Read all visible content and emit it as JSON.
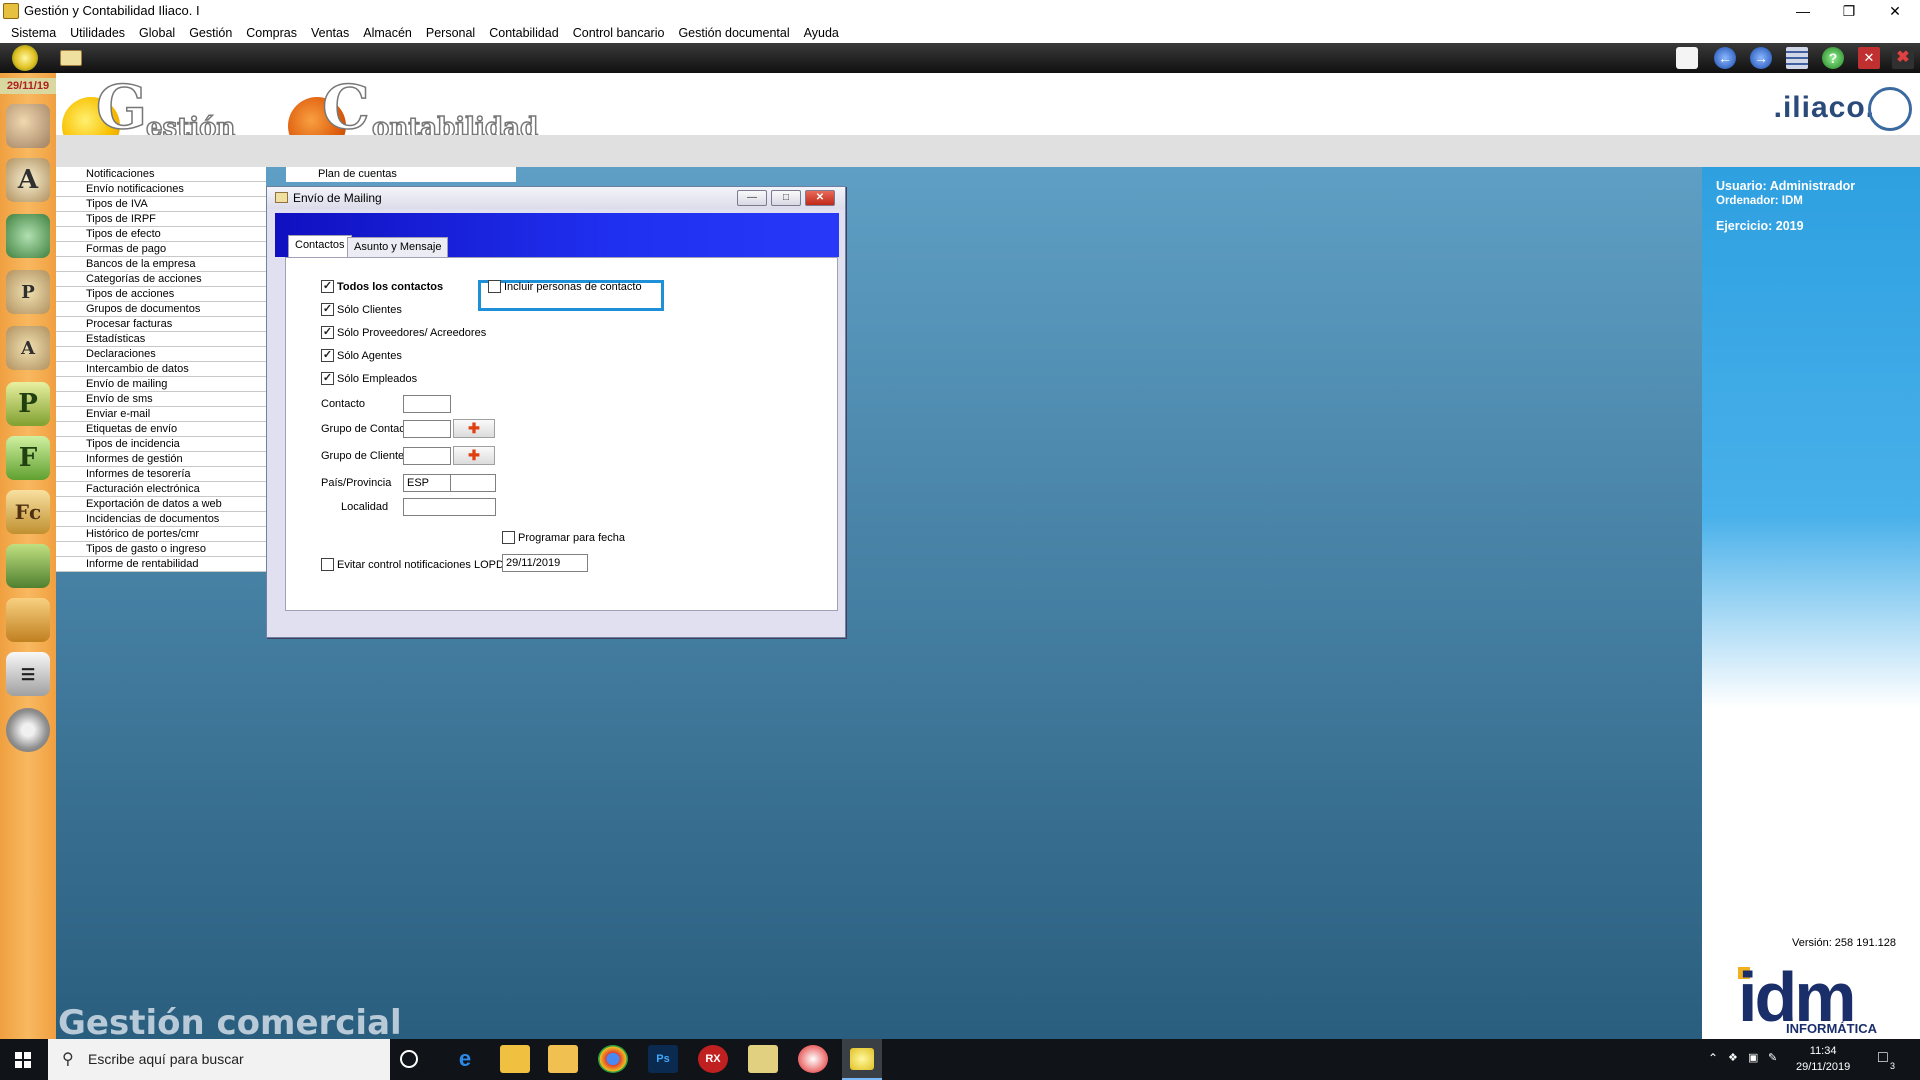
{
  "window": {
    "title": "Gestión y Contabilidad Iliaco. I"
  },
  "menu": [
    "Sistema",
    "Utilidades",
    "Global",
    "Gestión",
    "Compras",
    "Ventas",
    "Almacén",
    "Personal",
    "Contabilidad",
    "Control bancario",
    "Gestión documental",
    "Ayuda"
  ],
  "date_badge": "29/11/19",
  "logos": {
    "gestion_initial": "G",
    "gestion_rest": "estión",
    "contab_initial": "C",
    "contab_rest": "ontabilidad",
    "brand": ".iliaco."
  },
  "nav_items": [
    "Notificaciones",
    "Envío notificaciones",
    "Tipos de IVA",
    "Tipos de IRPF",
    "Tipos de efecto",
    "Formas de pago",
    "Bancos de la empresa",
    "Categorías de acciones",
    "Tipos de acciones",
    "Grupos de documentos",
    "Procesar facturas",
    "Estadísticas",
    "Declaraciones",
    "Intercambio de datos",
    "Envío de mailing",
    "Envío de sms",
    "Enviar e-mail",
    "Etiquetas de envío",
    "Tipos de incidencia",
    "Informes de gestión",
    "Informes de tesorería",
    "Facturación electrónica",
    "Exportación de datos a web",
    "Incidencias de documentos",
    "Histórico de portes/cmr",
    "Tipos de gasto o ingreso",
    "Informe de rentabilidad"
  ],
  "plan_tab": "Plan de cuentas",
  "dialog": {
    "title": "Envío de Mailing",
    "tabs": [
      "Contactos",
      "Asunto y Mensaje"
    ],
    "checks": {
      "todos": {
        "label": "Todos los contactos",
        "checked": true
      },
      "clientes": {
        "label": "Sólo Clientes",
        "checked": true
      },
      "proveedores": {
        "label": "Sólo Proveedores/ Acreedores",
        "checked": true
      },
      "agentes": {
        "label": "Sólo Agentes",
        "checked": true
      },
      "empleados": {
        "label": "Sólo Empleados",
        "checked": true
      },
      "incluir": {
        "label": "Incluir personas de contacto",
        "checked": false
      },
      "programar": {
        "label": "Programar para fecha",
        "checked": false
      },
      "lopd": {
        "label": "Evitar control notificaciones LOPD",
        "checked": false
      }
    },
    "fields": {
      "contacto_label": "Contacto",
      "contacto_value": "",
      "grupo_contactos_label": "Grupo de Contactos",
      "grupo_contactos_value": "",
      "grupo_clientes_label": "Grupo de Clientes",
      "grupo_clientes_value": "",
      "pais_label": "País/Provincia",
      "pais_value": "ESP",
      "provincia_value": "",
      "localidad_label": "Localidad",
      "localidad_value": "",
      "fecha_value": "29/11/2019"
    },
    "add_icon": "add-folder-icon"
  },
  "right_panel": {
    "usuario": "Usuario: Administrador",
    "ordenador": "Ordenador:  IDM",
    "ejercicio": "Ejercicio: 2019",
    "version": "Versión: 258 191.128",
    "logo": "idm",
    "logo_sub": "INFORMÁTICA"
  },
  "bottom_label": "Gestión comercial",
  "taskbar": {
    "search_placeholder": "Escribe aquí para buscar",
    "time": "11:34",
    "date": "29/11/2019",
    "notif_count": "3",
    "rx_label": "RX",
    "ps_label": "Ps"
  },
  "colors": {
    "accent": "#1e90d8",
    "dialog_header": "#1010c0",
    "right_panel": "#2ea0e0",
    "desktop": "#3a7a9e"
  }
}
